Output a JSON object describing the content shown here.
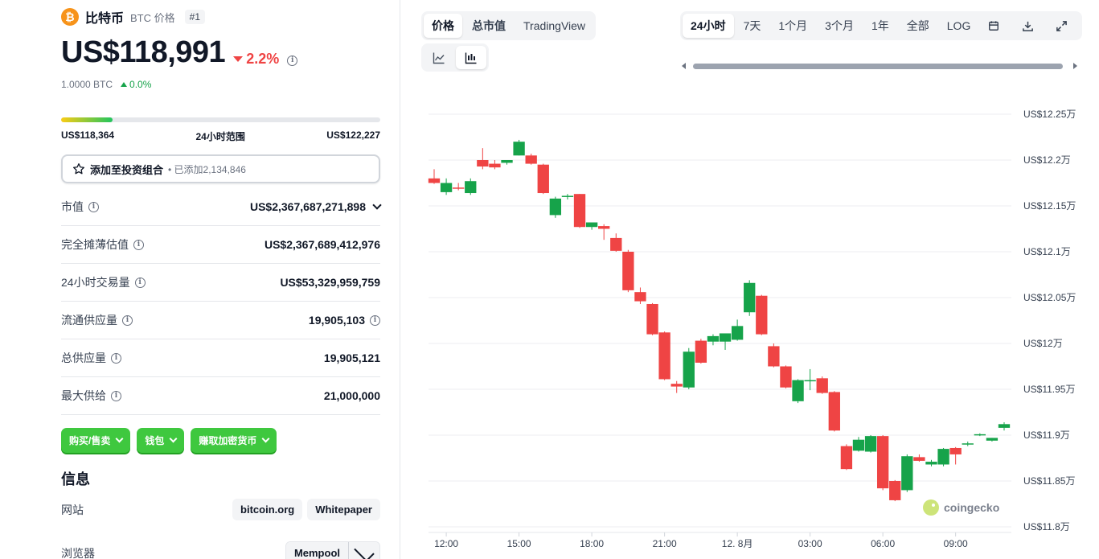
{
  "coin": {
    "logo_glyph": "₿",
    "name": "比特币",
    "sub": "BTC 价格",
    "rank": "#1",
    "price": "US$118,991",
    "change": "2.2%",
    "btc_price": "1.0000 BTC",
    "btc_change": "0.0%"
  },
  "range": {
    "low": "US$118,364",
    "label": "24小时范围",
    "high": "US$122,227",
    "position_fraction": 0.16
  },
  "portfolio": {
    "label": "添加至投资组合",
    "added": "• 已添加2,134,846"
  },
  "stats": [
    {
      "label": "市值",
      "value": "US$2,367,687,271,898"
    },
    {
      "label": "完全摊薄估值",
      "value": "US$2,367,689,412,976"
    },
    {
      "label": "24小时交易量",
      "value": "US$53,329,959,759"
    },
    {
      "label": "流通供应量",
      "value": "19,905,103"
    },
    {
      "label": "总供应量",
      "value": "19,905,121"
    },
    {
      "label": "最大供给",
      "value": "21,000,000"
    }
  ],
  "actions": {
    "buy_sell": "购买/售卖",
    "wallet": "钱包",
    "earn": "赚取加密货币"
  },
  "info": {
    "title": "信息",
    "website_label": "网站",
    "website_links": [
      "bitcoin.org",
      "Whitepaper"
    ],
    "explorer_label": "浏览器",
    "explorer_link": "Mempool"
  },
  "chart_tabs": {
    "price": "价格",
    "market_cap": "总市值",
    "tradingview": "TradingView"
  },
  "chart_icons": {
    "line": "line-chart-icon",
    "candle": "candlestick-icon"
  },
  "ranges": [
    "24小时",
    "7天",
    "1个月",
    "3个月",
    "1年",
    "全部",
    "LOG"
  ],
  "tool_icons": [
    "calendar-icon",
    "download-icon",
    "expand-icon"
  ],
  "watermark": "coingecko",
  "colors": {
    "up": "#16a34a",
    "down": "#ef4444",
    "brand_btc": "#f7931a",
    "action_green": "#3fc83f"
  },
  "chart_data": {
    "type": "candlestick",
    "y_unit": "万",
    "y_ticks": [
      "US$12.25万",
      "US$12.2万",
      "US$12.15万",
      "US$12.1万",
      "US$12.05万",
      "US$12万",
      "US$11.95万",
      "US$11.9万",
      "US$11.85万",
      "US$11.8万"
    ],
    "y_values": [
      12.25,
      12.2,
      12.15,
      12.1,
      12.05,
      12.0,
      11.95,
      11.9,
      11.85,
      11.8
    ],
    "ylim": [
      11.8,
      12.25
    ],
    "x_ticks": [
      "12:00",
      "15:00",
      "18:00",
      "21:00",
      "12. 8月",
      "03:00",
      "06:00",
      "09:00"
    ],
    "x_tick_index": [
      1,
      7,
      13,
      19,
      25,
      31,
      37,
      43
    ],
    "candles": [
      {
        "o": 12.18,
        "h": 12.19,
        "l": 12.174,
        "c": 12.175
      },
      {
        "o": 12.165,
        "h": 12.18,
        "l": 12.162,
        "c": 12.175
      },
      {
        "o": 12.17,
        "h": 12.175,
        "l": 12.167,
        "c": 12.169
      },
      {
        "o": 12.164,
        "h": 12.18,
        "l": 12.162,
        "c": 12.177
      },
      {
        "o": 12.2,
        "h": 12.213,
        "l": 12.19,
        "c": 12.193
      },
      {
        "o": 12.196,
        "h": 12.2,
        "l": 12.19,
        "c": 12.192
      },
      {
        "o": 12.197,
        "h": 12.2,
        "l": 12.195,
        "c": 12.2
      },
      {
        "o": 12.205,
        "h": 12.222,
        "l": 12.205,
        "c": 12.22
      },
      {
        "o": 12.205,
        "h": 12.207,
        "l": 12.195,
        "c": 12.196
      },
      {
        "o": 12.195,
        "h": 12.196,
        "l": 12.163,
        "c": 12.164
      },
      {
        "o": 12.14,
        "h": 12.16,
        "l": 12.137,
        "c": 12.158
      },
      {
        "o": 12.16,
        "h": 12.163,
        "l": 12.157,
        "c": 12.161
      },
      {
        "o": 12.163,
        "h": 12.163,
        "l": 12.126,
        "c": 12.127
      },
      {
        "o": 12.127,
        "h": 12.13,
        "l": 12.124,
        "c": 12.132
      },
      {
        "o": 12.128,
        "h": 12.13,
        "l": 12.113,
        "c": 12.125
      },
      {
        "o": 12.115,
        "h": 12.12,
        "l": 12.1,
        "c": 12.101
      },
      {
        "o": 12.1,
        "h": 12.102,
        "l": 12.056,
        "c": 12.058
      },
      {
        "o": 12.056,
        "h": 12.061,
        "l": 12.043,
        "c": 12.046
      },
      {
        "o": 12.043,
        "h": 12.044,
        "l": 12.009,
        "c": 12.01
      },
      {
        "o": 12.012,
        "h": 12.013,
        "l": 11.96,
        "c": 11.961
      },
      {
        "o": 11.956,
        "h": 11.959,
        "l": 11.946,
        "c": 11.953
      },
      {
        "o": 11.952,
        "h": 11.995,
        "l": 11.95,
        "c": 11.991
      },
      {
        "o": 12.003,
        "h": 12.005,
        "l": 11.978,
        "c": 11.979
      },
      {
        "o": 12.002,
        "h": 12.01,
        "l": 11.998,
        "c": 12.008
      },
      {
        "o": 12.002,
        "h": 12.01,
        "l": 11.993,
        "c": 12.011
      },
      {
        "o": 12.004,
        "h": 12.026,
        "l": 12.003,
        "c": 12.019
      },
      {
        "o": 12.034,
        "h": 12.069,
        "l": 12.03,
        "c": 12.066
      },
      {
        "o": 12.052,
        "h": 12.053,
        "l": 12.009,
        "c": 12.01
      },
      {
        "o": 11.997,
        "h": 12.0,
        "l": 11.974,
        "c": 11.975
      },
      {
        "o": 11.975,
        "h": 11.976,
        "l": 11.951,
        "c": 11.952
      },
      {
        "o": 11.937,
        "h": 11.961,
        "l": 11.935,
        "c": 11.96
      },
      {
        "o": 11.959,
        "h": 11.972,
        "l": 11.949,
        "c": 11.96
      },
      {
        "o": 11.962,
        "h": 11.964,
        "l": 11.945,
        "c": 11.946
      },
      {
        "o": 11.947,
        "h": 11.948,
        "l": 11.904,
        "c": 11.905
      },
      {
        "o": 11.888,
        "h": 11.89,
        "l": 11.862,
        "c": 11.863
      },
      {
        "o": 11.883,
        "h": 11.898,
        "l": 11.882,
        "c": 11.895
      },
      {
        "o": 11.882,
        "h": 11.9,
        "l": 11.881,
        "c": 11.899
      },
      {
        "o": 11.899,
        "h": 11.9,
        "l": 11.84,
        "c": 11.842
      },
      {
        "o": 11.85,
        "h": 11.851,
        "l": 11.828,
        "c": 11.829
      },
      {
        "o": 11.84,
        "h": 11.879,
        "l": 11.838,
        "c": 11.877
      },
      {
        "o": 11.876,
        "h": 11.879,
        "l": 11.871,
        "c": 11.872
      },
      {
        "o": 11.868,
        "h": 11.873,
        "l": 11.866,
        "c": 11.871
      },
      {
        "o": 11.868,
        "h": 11.886,
        "l": 11.866,
        "c": 11.885
      },
      {
        "o": 11.886,
        "h": 11.887,
        "l": 11.868,
        "c": 11.879
      },
      {
        "o": 11.89,
        "h": 11.893,
        "l": 11.888,
        "c": 11.891
      },
      {
        "o": 11.9,
        "h": 11.902,
        "l": 11.899,
        "c": 11.901
      },
      {
        "o": 11.894,
        "h": 11.897,
        "l": 11.893,
        "c": 11.897
      },
      {
        "o": 11.908,
        "h": 11.914,
        "l": 11.905,
        "c": 11.912
      }
    ]
  }
}
